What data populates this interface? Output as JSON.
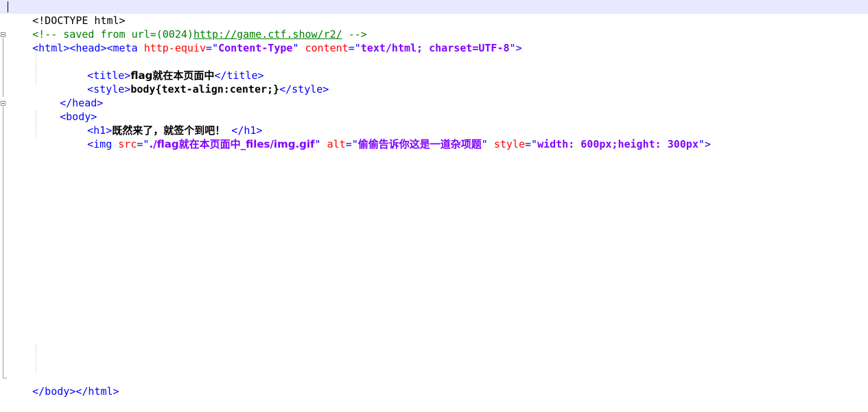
{
  "editor": {
    "doctype": "<!DOCTYPE html>",
    "comment_open": "<!-- saved from url=(0024)",
    "comment_url": "http://game.ctf.show/r2/",
    "comment_close": " -->",
    "html_open": "<html>",
    "head_open": "<head>",
    "meta_open": "<meta ",
    "meta_attr1": "http-equiv",
    "eq": "=",
    "quote": "\"",
    "meta_val1": "Content-Type",
    "meta_attr2": "content",
    "meta_val2": "text/html; charset=UTF-8",
    "tag_close": ">",
    "title_open": "<title>",
    "title_text": "flag就在本页面中",
    "title_close": "</title>",
    "style_open": "<style>",
    "style_text": "body{text-align:center;}",
    "style_close": "</style>",
    "head_close": "</head>",
    "body_open": "<body>",
    "h1_open": "<h1>",
    "h1_text": "既然来了，就签个到吧！",
    "h1_close": " </h1>",
    "img_open": "<img ",
    "img_attr1": "src",
    "img_val1": "./flag就在本页面中_files/img.gif",
    "img_attr2": "alt",
    "img_val2": "偷偷告诉你这是一道杂项题",
    "img_attr3": "style",
    "img_val3": "width: 600px;height: 300px",
    "body_html_close": "</body></html>"
  }
}
